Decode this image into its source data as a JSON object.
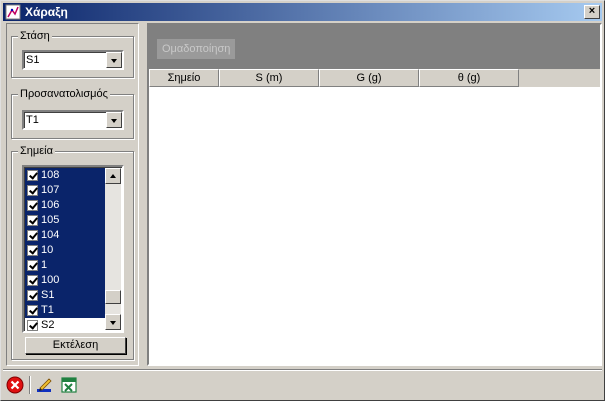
{
  "window": {
    "title": "Χάραξη",
    "close_label": "×"
  },
  "station": {
    "label": "Στάση",
    "value": "S1"
  },
  "orientation": {
    "label": "Προσανατολισμός",
    "value": "T1"
  },
  "points": {
    "label": "Σημεία",
    "items": [
      {
        "label": "108",
        "checked": true,
        "selected": true
      },
      {
        "label": "107",
        "checked": true,
        "selected": true
      },
      {
        "label": "106",
        "checked": true,
        "selected": true
      },
      {
        "label": "105",
        "checked": true,
        "selected": true
      },
      {
        "label": "104",
        "checked": true,
        "selected": true
      },
      {
        "label": "10",
        "checked": true,
        "selected": true
      },
      {
        "label": "1",
        "checked": true,
        "selected": true
      },
      {
        "label": "100",
        "checked": true,
        "selected": true
      },
      {
        "label": "S1",
        "checked": true,
        "selected": true
      },
      {
        "label": "T1",
        "checked": true,
        "selected": true
      },
      {
        "label": "S2",
        "checked": true,
        "selected": false
      }
    ]
  },
  "execute_label": "Εκτέλεση",
  "grouping_label": "Ομαδοποίηση",
  "table": {
    "columns": [
      "Σημείο",
      "S (m)",
      "G (g)",
      "θ (g)"
    ]
  },
  "toolbar": {
    "icons": [
      "close-circle-icon",
      "edit-pen-icon",
      "excel-icon"
    ]
  },
  "colors": {
    "selection": "#0a246a",
    "title_start": "#0a246a",
    "title_end": "#a6caf0"
  }
}
